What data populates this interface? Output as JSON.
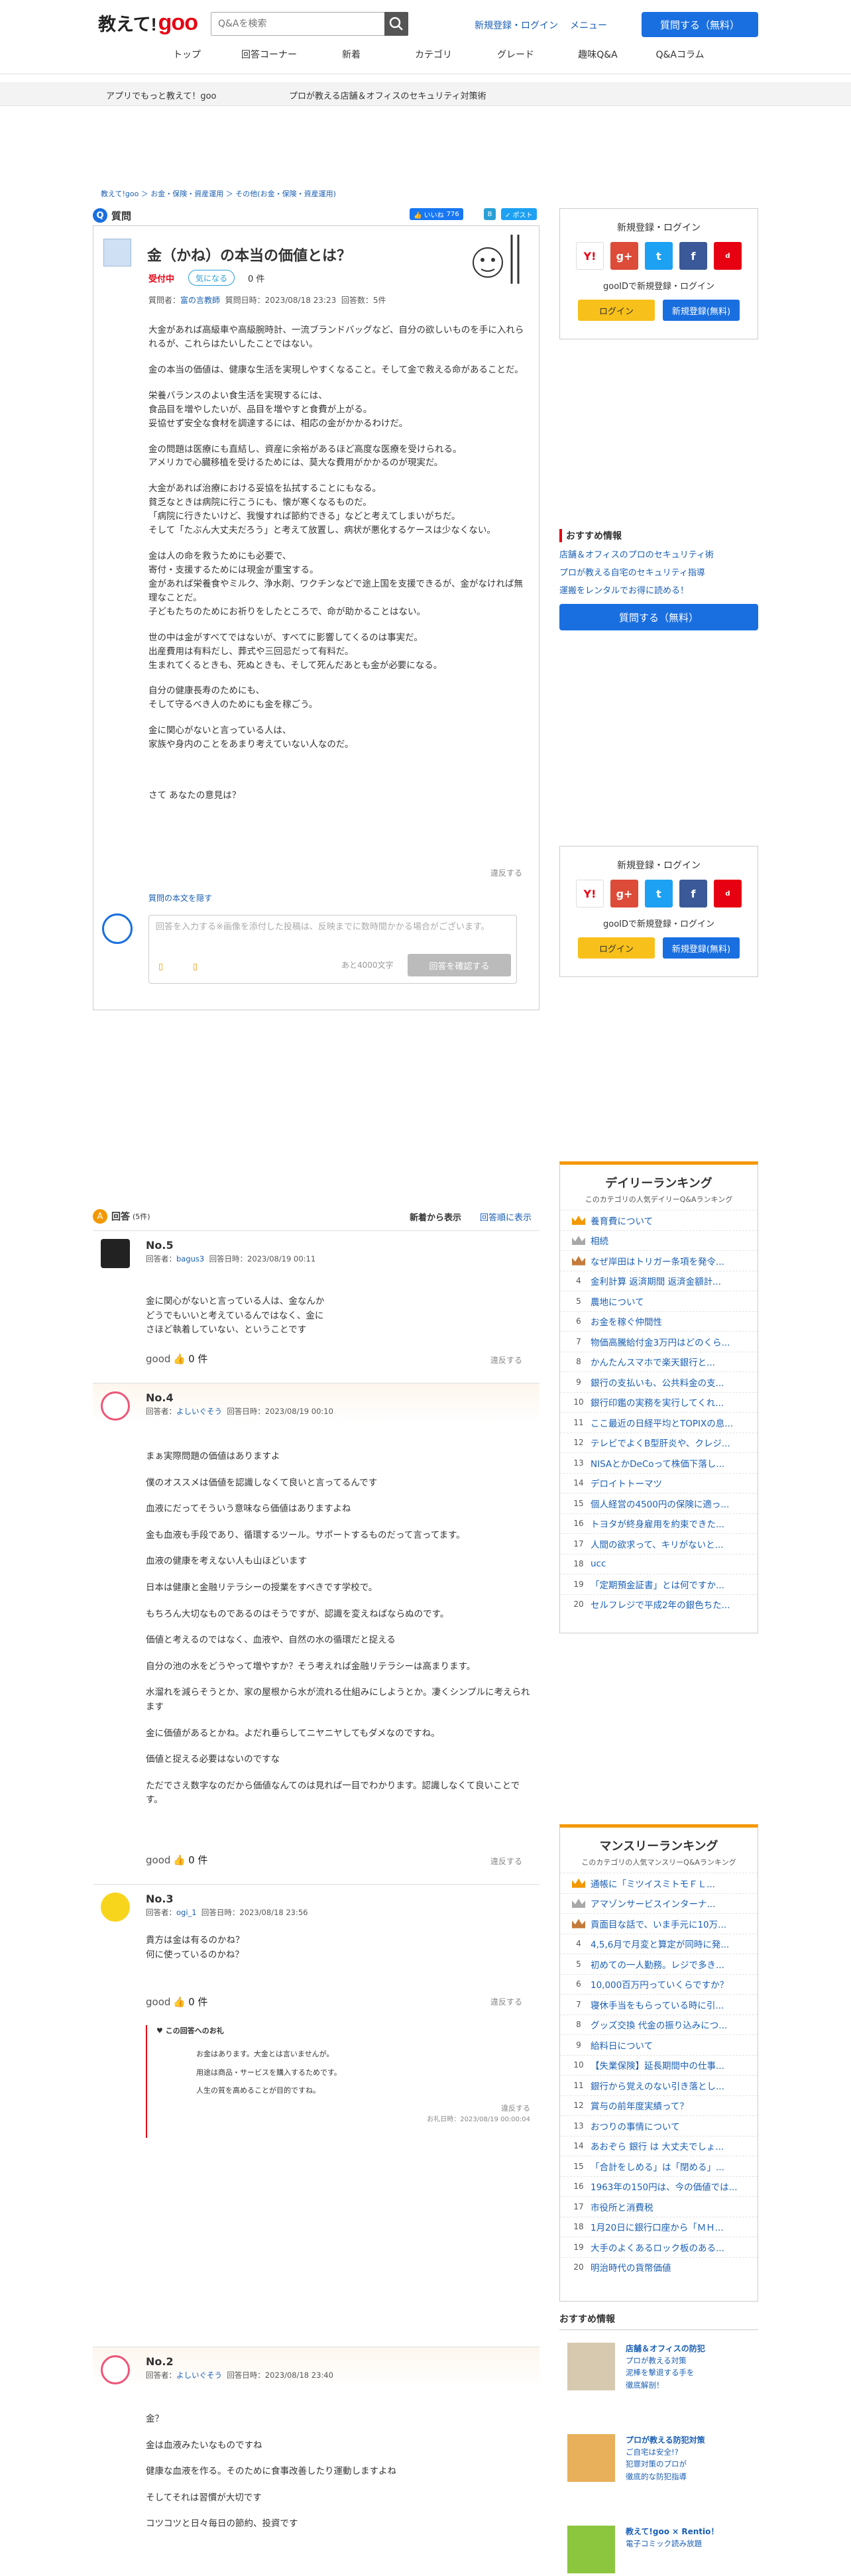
{
  "header": {
    "logo_prefix": "教えて!",
    "logo_brand": "goo",
    "search_placeholder": "Q&Aを検索",
    "login": "新規登録・ログイン",
    "menu": "メニュー",
    "ask": "質問する（無料）",
    "nav": [
      "トップ",
      "回答コーナー",
      "新着",
      "カテゴリ",
      "グレード",
      "趣味Q&A",
      "Q&Aコラム"
    ]
  },
  "crumbbar": {
    "app": "アプリでもっと教えて！goo",
    "pro": "プロが教える店舗＆オフィスのセキュリティ対策術"
  },
  "breadcrumb": "教えて!goo ＞ お金・保険・資産運用 ＞ その他(お金・保険・資産運用)",
  "question": {
    "label": "質問",
    "like_count": "776",
    "title": "金（かね）の本当の価値とは？",
    "status": "受付中",
    "kini": "気になる",
    "kini_count": "0 件",
    "meta_prefix": "質問者：",
    "user": "富の言教師",
    "date": "質問日時：2023/08/18 23:23",
    "answers": "回答数：5件",
    "body": [
      "大金があれば高級車や高級腕時計、一流ブランドバッグなど、自分の欲しいものを手に入れられるが、これらはたいしたことではない。",
      "金の本当の価値は、健康な生活を実現しやすくなること。そして金で救える命があることだ。",
      "栄養バランスのよい食生活を実現するには、\n食品目を増やしたいが、品目を増やすと食費が上がる。\n妥協せず安全な食材を調達するには、相応の金がかかるわけだ。",
      "金の問題は医療にも直結し、資産に余裕があるほど高度な医療を受けられる。\nアメリカで心臓移植を受けるためには、莫大な費用がかかるのが現実だ。",
      "大金があれば治療における妥協を払拭することにもなる。\n貧乏なときは病院に行こうにも、懐が寒くなるものだ。\n「病院に行きたいけど、我慢すれば節約できる」などと考えてしまいがちだ。\nそして「たぶん大丈夫だろう」と考えて放置し、病状が悪化するケースは少なくない。",
      "金は人の命を救うためにも必要で、\n寄付・支援するためには現金が重宝する。\n金があれば栄養食やミルク、浄水剤、ワクチンなどで途上国を支援できるが、金がなければ無理なことだ。\n子どもたちのためにお祈りをしたところで、命が助かることはない。",
      "世の中は金がすべてではないが、すべてに影響してくるのは事実だ。\n出産費用は有料だし、葬式や三回忌だって有料だ。\n生まれてくるときも、死ぬときも、そして死んだあとも金が必要になる。",
      "自分の健康長寿のためにも、\nそして守るべき人のためにも金を稼ごう。",
      "金に関心がないと言っている人は、\n家族や身内のことをあまり考えていない人なのだ。",
      "",
      "さて あなたの意見は？"
    ],
    "report": "違反する",
    "show_body": "質問の本文を隠す",
    "form_placeholder": "回答を入力する※画像を添付した投稿は、反映までに数時間かかる場合がございます。",
    "form_count": "あと4000文字",
    "form_button": "回答を確認する"
  },
  "sidebar": {
    "login_title": "新規登録・ログイン",
    "goo_login": "gooIDで新規登録・ログイン",
    "login_btn": "ログイン",
    "register_btn": "新規登録(無料)",
    "rec_title": "おすすめ情報",
    "rec_items": [
      "店舗＆オフィスのプロのセキュリティ術",
      "プロが教える自宅のセキュリティ指導",
      "運搬をレンタルでお得に読める！"
    ],
    "ask": "質問する（無料）",
    "daily": {
      "title": "デイリーランキング",
      "sub": "このカテゴリの人気デイリーQ&Aランキング",
      "items": [
        "養育費について",
        "相続",
        "なぜ岸田はトリガー条項を発令...",
        "金利計算 返済期間 返済金額計...",
        "農地について",
        "お金を稼ぐ仲間性",
        "物価高騰給付金3万円はどのくら...",
        "かんたんスマホで楽天銀行と...",
        "銀行の支払いも、公共料金の支...",
        "銀行印鑑の実務を実行してくれ...",
        "ここ最近の日経平均とTOPIXの息...",
        "テレビでよくB型肝炎や、クレジ...",
        "NISAとかDeCoって株価下落し...",
        "デロイトトーマツ",
        "個人経営の4500円の保険に適っ...",
        "トヨタが終身雇用を約束できた...",
        "人間の欲求って、キリがないと...",
        "ucc",
        "「定期預金証書」とは何ですか...",
        "セルフレジで平成2年の銀色ちた..."
      ]
    },
    "monthly": {
      "title": "マンスリーランキング",
      "sub": "このカテゴリの人気マンスリーQ&Aランキング",
      "items": [
        "通帳に「ミツイスミトモＦＬ...",
        "アマゾンサービスインターナ...",
        "貢面目な話で、いま手元に10万...",
        "4,5,6月で月変と算定が同時に発...",
        "初めての一人勤務。レジで多き...",
        "10,000百万円っていくらですか？",
        "寝休手当をもらっている時に引...",
        "グッズ交換 代金の振り込みにつ...",
        "給料日について",
        "【失業保険】延長期間中の仕事...",
        "銀行から覚えのない引き落とし...",
        "賞与の前年度実績って？",
        "おつりの事情について",
        "あおぞら 銀行 は 大丈夫でしょ...",
        "「合計をしめる」は「閉める」...",
        "1963年の150円は、今の価値では...",
        "市役所と消費税",
        "1月20日に銀行口座から「ＭＨ...",
        "大手のよくあるロック板のある...",
        "明治時代の貨幣価値"
      ]
    },
    "recommend": {
      "title": "おすすめ情報",
      "items": [
        {
          "title": "店舗＆オフィスの防犯",
          "links": [
            "プロが教える対策",
            "泥棒を撃退する手を",
            "徹底解剖！"
          ]
        },
        {
          "title": "プロが教える防犯対策",
          "links": [
            "ご自宅は安全!?",
            "犯罪対策のプロが",
            "徹底的な防犯指導"
          ]
        },
        {
          "title": "教えて!goo × Rentio！",
          "links": [
            "電子コミック読み放題"
          ]
        }
      ]
    }
  },
  "answers": {
    "label": "回答",
    "count": "(5件)",
    "tab_new": "新着から表示",
    "tab_old": "回答順に表示",
    "good": "good",
    "good_count": "0 件",
    "report": "違反する",
    "list": [
      {
        "no": "No.5",
        "user": "bagus3",
        "date": "回答日時：2023/08/19 00:11",
        "body": [
          "金に関心がないと言っている人は、金なんか\nどうでもいいと考えているんではなく、金に\nさほど執着していない、ということです"
        ]
      },
      {
        "no": "No.4",
        "user": "よしいぐそう",
        "date": "回答日時：2023/08/19 00:10",
        "body": [
          "まぁ実際問題の価値はありますよ",
          "僕のオススメは価値を認識しなくて良いと言ってるんです",
          "血液にだってそういう意味なら価値はありますよね",
          "金も血液も手段であり、循環するツール。サポートするものだって言ってます。",
          "血液の健康を考えない人も山ほどいます",
          "日本は健康と金融リテラシーの授業をすべきです学校で。",
          "もちろん大切なものであるのはそうですが、認識を変えねばならぬのです。",
          "価値と考えるのではなく、血液や、自然の水の循環だと捉える",
          "自分の池の水をどうやって増やすか？そう考えれば金融リテラシーは高まります。",
          "水溜れを減らそうとか、家の屋根から水が流れる仕組みにしようとか。凄くシンプルに考えられます",
          "金に価値があるとかね。よだれ垂らしてニヤニヤしてもダメなのですね。",
          "価値と捉える必要はないのですな",
          "ただでさえ数字なのだから価値なんてのは見れば一目でわかります。認識しなくて良いことです。"
        ]
      },
      {
        "no": "No.3",
        "user": "ogi_1",
        "date": "回答日時：2023/08/18 23:56",
        "body": [
          "貴方は金は有るのかね？\n何に使っているのかね？"
        ],
        "thanks": {
          "title": "この回答へのお礼",
          "lines": [
            "お金はあります。大金とは言いませんが。",
            "用途は商品・サービスを購入するためです。",
            "人生の質を高めることが目的ですね。"
          ],
          "date": "お礼日時：2023/08/19 00:00:04"
        }
      },
      {
        "no": "No.2",
        "user": "よしいぐそう",
        "date": "回答日時：2023/08/18 23:40",
        "body": [
          "金？",
          "金は血液みたいなものですね",
          "健康な血液を作る。そのために食事改善したり運動しますよね",
          "そしてそれは習慣が大切です",
          "コツコツと日々毎日の節約、投資です"
        ]
      }
    ]
  },
  "colors": {
    "brand_red": "#e60012",
    "accent_blue": "#1a6fe0",
    "link": "#1a5fb4",
    "rank_orange": "#f39800"
  }
}
